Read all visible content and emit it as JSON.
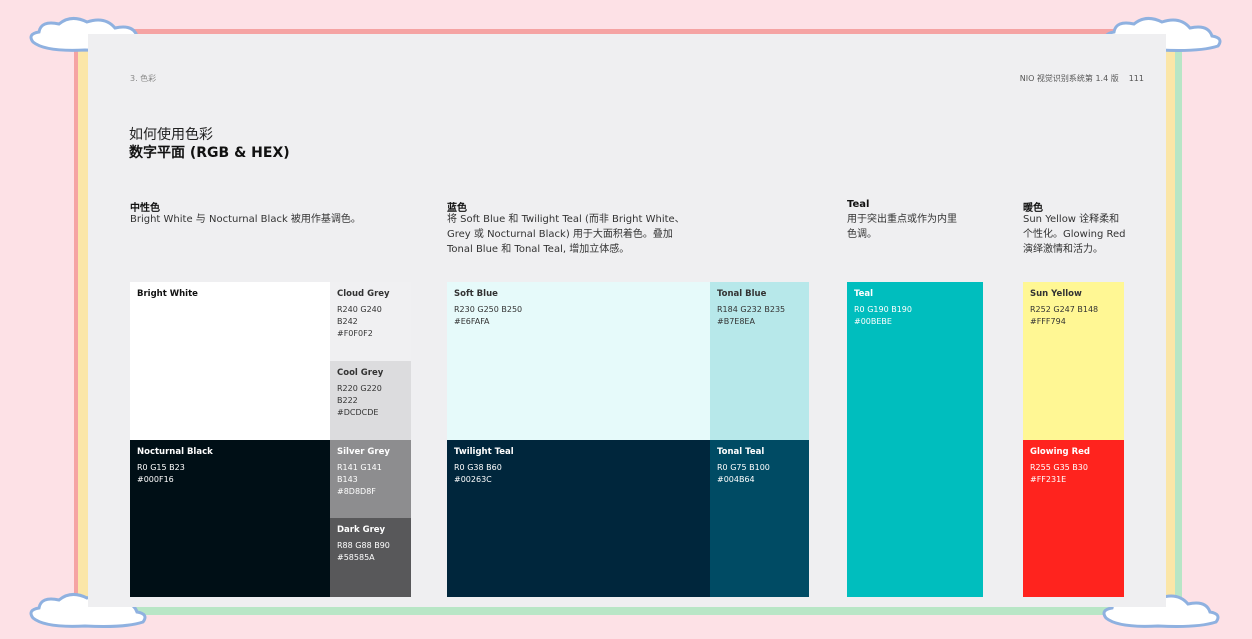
{
  "header": {
    "section": "3. 色彩",
    "doc_title": "NIO 视觉识别系统第 1.4 版",
    "page_number": "111"
  },
  "title": {
    "line1": "如何使用色彩",
    "line2": "数字平面 (RGB & HEX)"
  },
  "sections": {
    "neutral": {
      "title": "中性色",
      "desc": [
        "Bright White 与 Nocturnal Black 被用作基调色。"
      ]
    },
    "blue": {
      "title": "蓝色",
      "desc": [
        "将 Soft Blue 和 Twilight Teal (而非 Bright White、",
        "Grey 或 Nocturnal Black) 用于大面积着色。叠加",
        "Tonal Blue 和 Tonal Teal, 增加立体感。"
      ]
    },
    "teal": {
      "title": "Teal",
      "desc": [
        "用于突出重点或作为内里",
        "色调。"
      ]
    },
    "warm": {
      "title": "暖色",
      "desc": [
        "Sun Yellow 诠释柔和",
        "个性化。Glowing Red",
        "演绎激情和活力。"
      ]
    }
  },
  "swatches": {
    "bright_white": {
      "name": "Bright White",
      "bg": "#FFFFFF",
      "fg": "#111111"
    },
    "cloud_grey": {
      "name": "Cloud Grey",
      "rgb": "R240 G240 B242",
      "hex": "#F0F0F2",
      "bg": "#F0F0F2",
      "fg": "#333333"
    },
    "cool_grey": {
      "name": "Cool Grey",
      "rgb": "R220 G220 B222",
      "hex": "#DCDCDE",
      "bg": "#DCDCDE",
      "fg": "#333333"
    },
    "nocturnal_black": {
      "name": "Nocturnal Black",
      "rgb": "R0 G15 B23",
      "hex": "#000F16",
      "bg": "#000F16",
      "fg": "#FFFFFF"
    },
    "silver_grey": {
      "name": "Silver Grey",
      "rgb": "R141 G141 B143",
      "hex": "#8D8D8F",
      "bg": "#8D8D8F",
      "fg": "#FFFFFF"
    },
    "dark_grey": {
      "name": "Dark Grey",
      "rgb": "R88 G88 B90",
      "hex": "#58585A",
      "bg": "#58585A",
      "fg": "#FFFFFF"
    },
    "soft_blue": {
      "name": "Soft Blue",
      "rgb": "R230 G250 B250",
      "hex": "#E6FAFA",
      "bg": "#E6FAFA",
      "fg": "#333333"
    },
    "tonal_blue": {
      "name": "Tonal Blue",
      "rgb": "R184 G232 B235",
      "hex": "#B7E8EA",
      "bg": "#B7E8EA",
      "fg": "#333333"
    },
    "twilight_teal": {
      "name": "Twilight Teal",
      "rgb": "R0 G38 B60",
      "hex": "#00263C",
      "bg": "#00263C",
      "fg": "#FFFFFF"
    },
    "tonal_teal": {
      "name": "Tonal Teal",
      "rgb": "R0 G75 B100",
      "hex": "#004B64",
      "bg": "#004B64",
      "fg": "#FFFFFF"
    },
    "teal": {
      "name": "Teal",
      "rgb": "R0 G190 B190",
      "hex": "#00BEBE",
      "bg": "#00BEBE",
      "fg": "#FFFFFF"
    },
    "sun_yellow": {
      "name": "Sun Yellow",
      "rgb": "R252 G247 B148",
      "hex": "#FFF794",
      "bg": "#FFF794",
      "fg": "#333333"
    },
    "glowing_red": {
      "name": "Glowing Red",
      "rgb": "R255 G35 B30",
      "hex": "#FF231E",
      "bg": "#FF231E",
      "fg": "#FFFFFF"
    }
  },
  "decor": {
    "cloud_color": "#bcd3ee",
    "frame_red": "#f5a3a3",
    "frame_green": "#b8e6c6",
    "page_bg": "#efeff1"
  }
}
